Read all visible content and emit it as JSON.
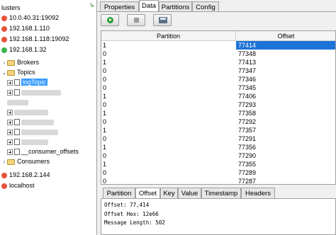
{
  "tree": {
    "clusters_label": "lusters",
    "items": [
      {
        "label": "10.0.40.31:19092",
        "status": "red"
      },
      {
        "label": "192.168.1.110",
        "status": "red"
      },
      {
        "label": "192.168.1.118:19092",
        "status": "red"
      },
      {
        "label": "192.168.1.32",
        "status": "green"
      }
    ],
    "brokers_label": "Brokers",
    "topics_label": "Topics",
    "selected_topic": "logTopic",
    "consumer_offsets_label": "__consumer_offsets",
    "consumers_label": "Consumers",
    "after_items": [
      {
        "label": "192.168.2.144",
        "status": "red"
      },
      {
        "label": "localhost",
        "status": "red"
      }
    ]
  },
  "tabs": [
    "Properties",
    "Data",
    "Partitions",
    "Config"
  ],
  "active_tab": "Data",
  "table": {
    "columns": [
      "Partition",
      "Offset"
    ],
    "rows": [
      {
        "partition": "1",
        "offset": "77414"
      },
      {
        "partition": "0",
        "offset": "77348"
      },
      {
        "partition": "1",
        "offset": "77413"
      },
      {
        "partition": "0",
        "offset": "77347"
      },
      {
        "partition": "0",
        "offset": "77346"
      },
      {
        "partition": "0",
        "offset": "77345"
      },
      {
        "partition": "1",
        "offset": "77406"
      },
      {
        "partition": "0",
        "offset": "77293"
      },
      {
        "partition": "1",
        "offset": "77358"
      },
      {
        "partition": "0",
        "offset": "77292"
      },
      {
        "partition": "1",
        "offset": "77357"
      },
      {
        "partition": "0",
        "offset": "77291"
      },
      {
        "partition": "1",
        "offset": "77356"
      },
      {
        "partition": "0",
        "offset": "77290"
      },
      {
        "partition": "1",
        "offset": "77355"
      },
      {
        "partition": "0",
        "offset": "77289"
      },
      {
        "partition": "0",
        "offset": "77287"
      }
    ]
  },
  "detail_tabs": [
    "Partition",
    "Offset",
    "Key",
    "Value",
    "Timestamp",
    "Headers"
  ],
  "active_detail_tab": "Offset",
  "detail": {
    "offset_line": "Offset: 77,414",
    "offset_hex_line": "Offset Hex: 12e66",
    "message_length_line": "Message Length: 502"
  },
  "colors": {
    "selection": "#1e73d8",
    "status_red": "#e8533a",
    "status_green": "#3bb34a"
  }
}
